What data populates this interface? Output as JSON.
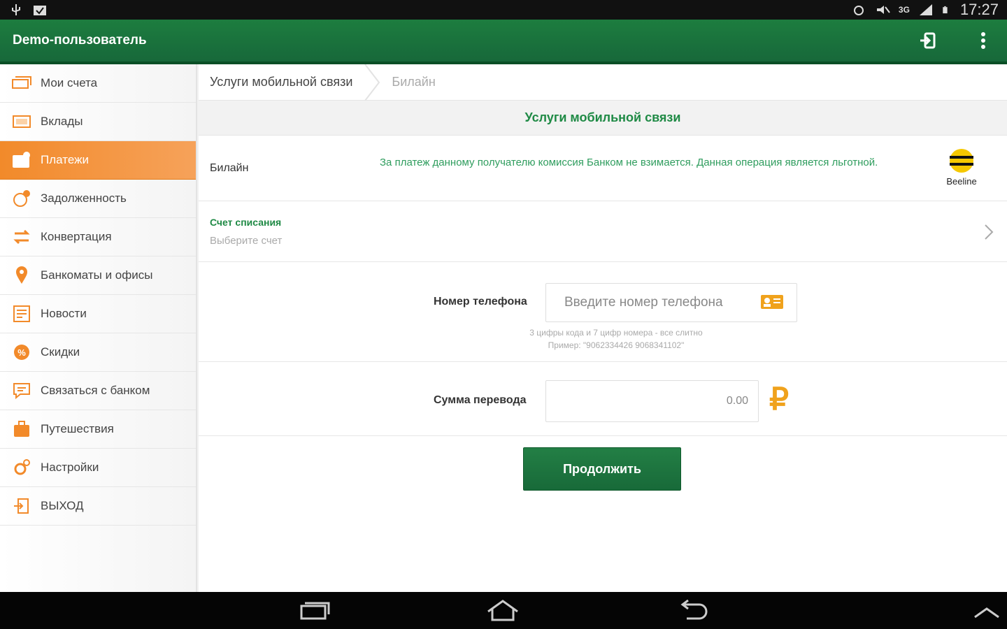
{
  "status_bar": {
    "time": "17:27",
    "network": "3G",
    "icons": [
      "usb-icon",
      "checklist-icon",
      "alarm-icon",
      "mute-icon",
      "network-icon",
      "signal-icon",
      "battery-icon"
    ]
  },
  "app_bar": {
    "title": "Demo-пользователь",
    "actions": [
      "login-icon",
      "overflow-menu-icon"
    ]
  },
  "sidebar": {
    "items": [
      {
        "label": "Мои счета",
        "icon": "accounts-icon",
        "active": false
      },
      {
        "label": "Вклады",
        "icon": "deposits-icon",
        "active": false
      },
      {
        "label": "Платежи",
        "icon": "payments-icon",
        "active": true
      },
      {
        "label": "Задолженность",
        "icon": "debt-icon",
        "active": false
      },
      {
        "label": "Конвертация",
        "icon": "exchange-icon",
        "active": false
      },
      {
        "label": "Банкоматы и офисы",
        "icon": "location-pin-icon",
        "active": false
      },
      {
        "label": "Новости",
        "icon": "news-icon",
        "active": false
      },
      {
        "label": "Скидки",
        "icon": "discount-icon",
        "active": false
      },
      {
        "label": "Связаться с банком",
        "icon": "chat-icon",
        "active": false
      },
      {
        "label": "Путешествия",
        "icon": "suitcase-icon",
        "active": false
      },
      {
        "label": "Настройки",
        "icon": "settings-icon",
        "active": false
      },
      {
        "label": "ВЫХОД",
        "icon": "exit-icon",
        "active": false
      }
    ]
  },
  "breadcrumb": {
    "items": [
      "Услуги мобильной связи",
      "Билайн"
    ]
  },
  "section": {
    "title": "Услуги мобильной связи"
  },
  "provider": {
    "name": "Билайн",
    "note": "За платеж данному получателю комиссия Банком не взимается. Данная операция является льготной.",
    "logo_text": "Beeline"
  },
  "account": {
    "label": "Счет списания",
    "hint": "Выберите счет"
  },
  "phone": {
    "label": "Номер телефона",
    "placeholder": "Введите номер телефона",
    "hint_line1": "3 цифры кода и 7 цифр номера - все слитно",
    "hint_line2": "Пример: \"9062334426 9068341102\""
  },
  "amount": {
    "label": "Сумма перевода",
    "value": "0.00",
    "currency": "₽"
  },
  "continue_label": "Продолжить",
  "colors": {
    "brand_green": "#1d7d3f",
    "accent_orange": "#f28a2a",
    "note_green": "#2f9d5e"
  }
}
